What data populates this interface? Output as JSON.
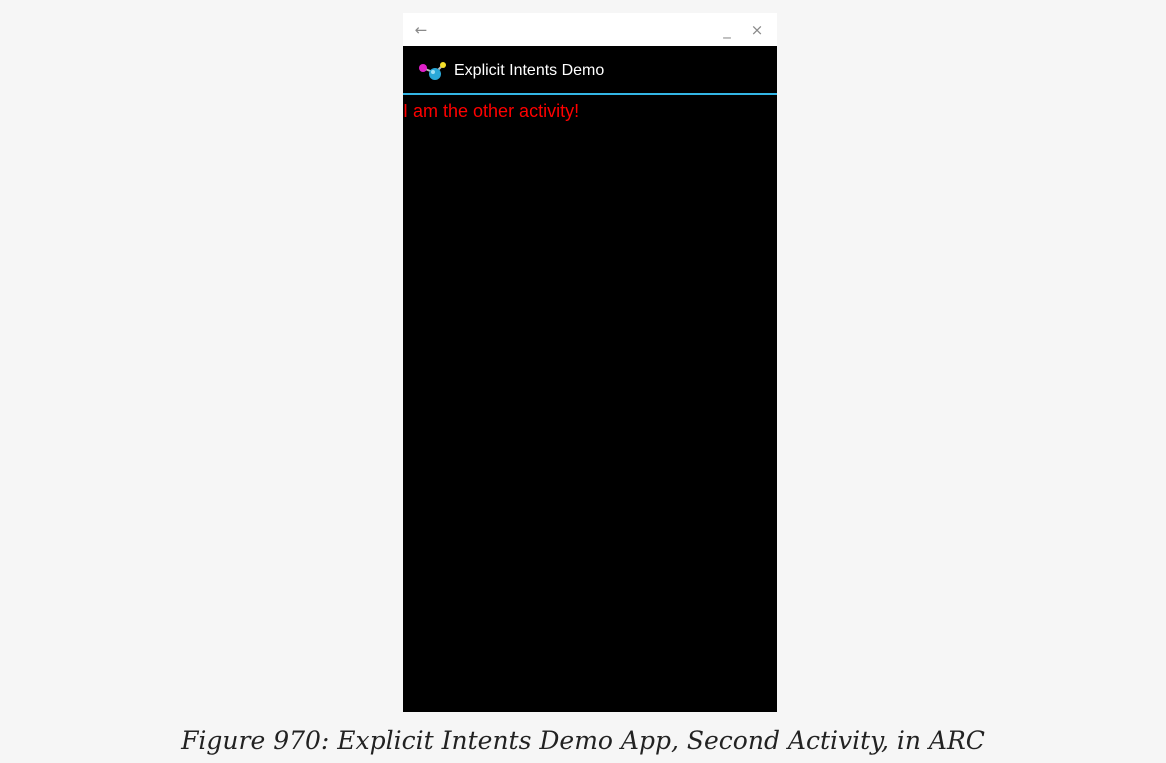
{
  "window": {
    "back_icon": "←",
    "minimize_icon": "_",
    "close_icon": "×"
  },
  "app": {
    "icon_name": "molecule-icon",
    "title": "Explicit Intents Demo",
    "accent_color": "#33b5e5"
  },
  "content": {
    "message": "I am the other activity!",
    "message_color": "#ff0000"
  },
  "caption": "Figure 970: Explicit Intents Demo App, Second Activity, in ARC"
}
